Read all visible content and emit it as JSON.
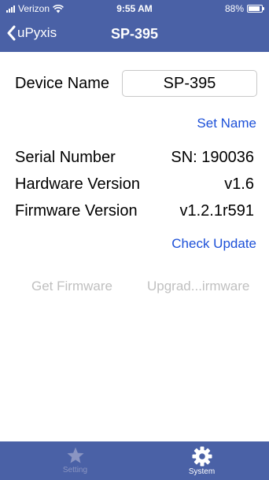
{
  "status_bar": {
    "carrier": "Verizon",
    "time": "9:55 AM",
    "battery_text": "88%",
    "battery_level": 0.88
  },
  "nav": {
    "back_label": "uPyxis",
    "title": "SP-395"
  },
  "device": {
    "name_label": "Device Name",
    "name_value": "SP-395",
    "set_name_label": "Set Name",
    "serial_label": "Serial Number",
    "serial_value": "SN: 190036",
    "hardware_label": "Hardware Version",
    "hardware_value": "v1.6",
    "firmware_label": "Firmware Version",
    "firmware_value": "v1.2.1r591",
    "check_update_label": "Check Update",
    "get_firmware_label": "Get Firmware",
    "upgrade_firmware_label": "Upgrad...irmware"
  },
  "tabs": [
    {
      "label": "Setting",
      "icon": "star-icon",
      "active": false
    },
    {
      "label": "System",
      "icon": "gear-icon",
      "active": true
    }
  ],
  "colors": {
    "bar": "#4a61a6",
    "link": "#1c50d8",
    "disabled": "#c0c0c0",
    "tab_inactive": "#8a95c2"
  }
}
